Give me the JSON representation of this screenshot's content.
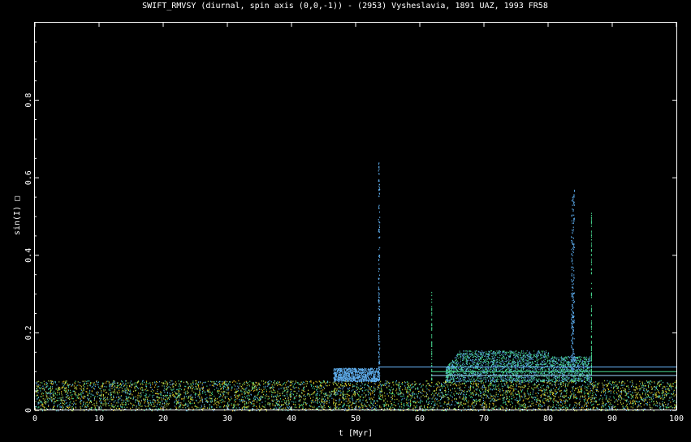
{
  "chart_data": {
    "type": "scatter",
    "title": "SWIFT_RMVSY (diurnal, spin axis (0,0,-1)) - (2953) Vysheslavia, 1891 UAZ, 1993 FR58",
    "xlabel": "t [Myr]",
    "ylabel": "sin(I) □",
    "xlim": [
      0,
      100
    ],
    "ylim": [
      0,
      1
    ],
    "x_ticks": [
      "0",
      "10",
      "20",
      "30",
      "40",
      "50",
      "60",
      "70",
      "80",
      "90",
      "100"
    ],
    "y_ticks": [
      "0",
      "0.2",
      "0.4",
      "0.6",
      "0.8"
    ],
    "grid": false,
    "legend": "none",
    "background": "#000000",
    "series": [
      {
        "color": "#a8d04a",
        "description_points": [
          [
            0,
            0.035
          ],
          [
            100,
            0.035
          ]
        ],
        "band": [
          0.0,
          0.078
        ]
      },
      {
        "color": "#60b0f0",
        "points": [
          [
            46.5,
            0.11
          ],
          [
            47,
            0.1
          ],
          [
            48,
            0.1
          ],
          [
            50,
            0.1
          ],
          [
            52,
            0.1
          ],
          [
            53.4,
            0.11
          ],
          [
            53.6,
            0.65
          ]
        ]
      },
      {
        "color": "#48d890",
        "points": [
          [
            61.8,
            0.31
          ],
          [
            66,
            0.15
          ],
          [
            70,
            0.155
          ],
          [
            75,
            0.15
          ],
          [
            80,
            0.145
          ],
          [
            83.8,
            0.57
          ],
          [
            86.7,
            0.51
          ]
        ]
      }
    ],
    "flat_lines": [
      {
        "color": "#6ab8ff",
        "x": [
          53.5,
          100
        ],
        "y": 0.112
      },
      {
        "color": "#48d890",
        "x": [
          61.8,
          100
        ],
        "y": 0.1
      },
      {
        "color": "#a0d8ff",
        "x": [
          61.8,
          100
        ],
        "y": 0.09
      }
    ]
  }
}
